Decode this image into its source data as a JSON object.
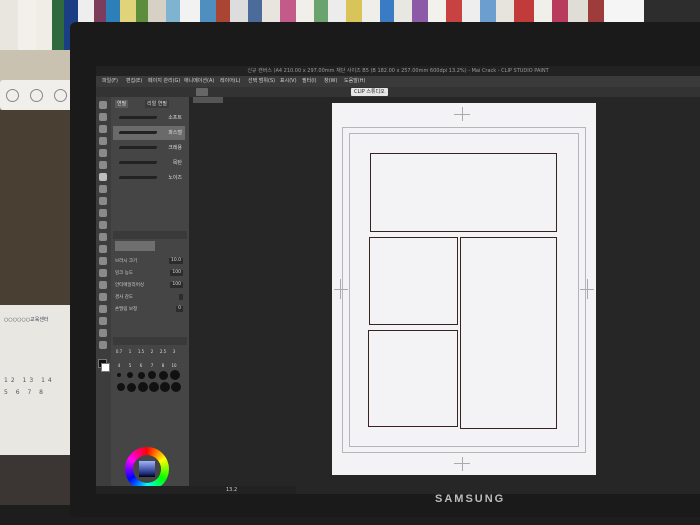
{
  "app": {
    "title": "신규 캔버스 (A4 210.00 x 297.00mm 재단 사이즈 B5 (B 182.00 x 257.00mm 600dpi 13.2%) - Mai Crack - CLIP STUDIO PAINT"
  },
  "menu": [
    "파일(F)",
    "편집(E)",
    "페이지 관리(G)",
    "애니메이션(A)",
    "레이어(L)",
    "선택 범위(S)",
    "표시(V)",
    "필터(I)",
    "창(W)",
    "도움말(H)"
  ],
  "command_bar": {
    "clip_button": "CLIP 스튜디오"
  },
  "tool_panel": {
    "tabs": [
      "연필",
      "리얼 연필"
    ],
    "subtools": [
      "소프트",
      "파스텔",
      "크레용",
      "목탄",
      "노이즈"
    ],
    "properties": [
      {
        "label": "브러시 크기",
        "value": "10.0"
      },
      {
        "label": "잉크 농도",
        "value": "100"
      },
      {
        "label": "안티에일리어싱",
        "value": "100"
      },
      {
        "label": "경사 감도",
        "value": ""
      },
      {
        "label": "손떨림 보정",
        "value": "0"
      }
    ],
    "brush_sizes_row1": [
      "0.7",
      "1",
      "1.5",
      "2",
      "2.5",
      "3"
    ],
    "brush_sizes_row2": [
      "4",
      "5",
      "6",
      "7",
      "8",
      "10"
    ]
  },
  "status": {
    "zoom": "13.2"
  },
  "monitor": {
    "brand": "SAMSUNG"
  },
  "calendar": {
    "title": "○○○○○○교육센터",
    "numbers": "12 13 14 5 6 7 8"
  },
  "colors": {
    "accent": "#3a2222",
    "wheel": "conic"
  }
}
